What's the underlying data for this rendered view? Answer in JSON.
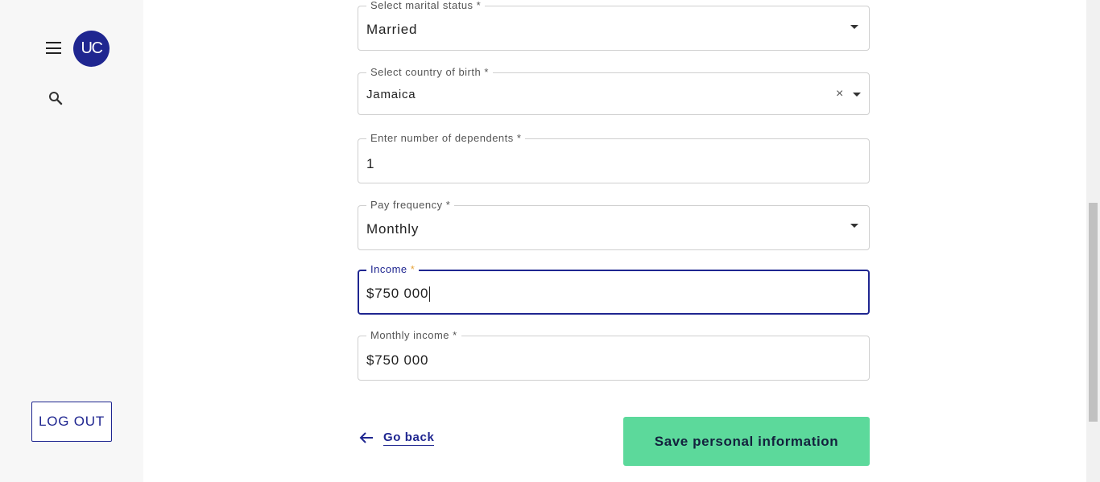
{
  "sidebar": {
    "avatar_initials": "UC",
    "menu_icon": "hamburger-menu-icon",
    "search_icon": "search-icon",
    "logout_label": "LOG OUT"
  },
  "form": {
    "marital_status": {
      "label": "Select marital status *",
      "value": "Married"
    },
    "country_of_birth": {
      "label": "Select country of birth *",
      "value": "Jamaica"
    },
    "dependents": {
      "label": "Enter number of dependents *",
      "value": "1"
    },
    "pay_frequency": {
      "label": "Pay frequency *",
      "value": "Monthly"
    },
    "income": {
      "label": "Income",
      "required_mark": "*",
      "value": "$750 000"
    },
    "monthly_income": {
      "label": "Monthly income *",
      "value": "$750 000"
    }
  },
  "actions": {
    "go_back_label": "Go back",
    "save_label": "Save personal information"
  },
  "colors": {
    "accent": "#1f2690",
    "save_button": "#5cd99b",
    "sidebar_bg": "#f7f7f7"
  }
}
